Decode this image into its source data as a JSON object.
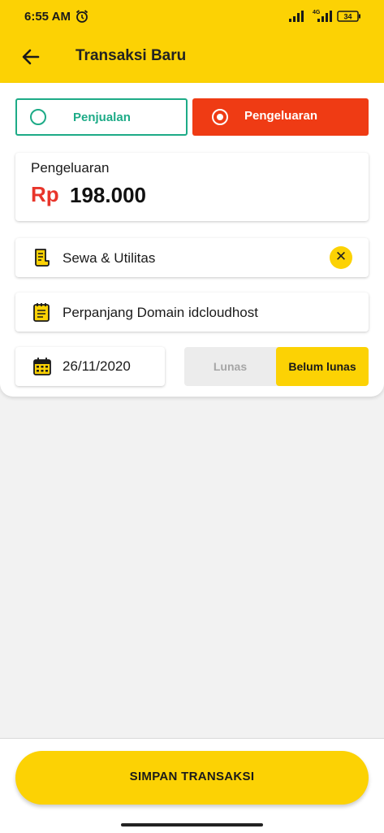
{
  "status_bar": {
    "time": "6:55 AM",
    "network": "4G",
    "battery": "34",
    "icons": [
      "alarm-icon",
      "signal-icon",
      "signal-4g-icon",
      "battery-icon"
    ]
  },
  "app_bar": {
    "title": "Transaksi Baru",
    "back_icon": "arrow-left-icon"
  },
  "transaction_type": {
    "options": [
      {
        "label": "Penjualan",
        "selected": false,
        "color": "#1dab87"
      },
      {
        "label": "Pengeluaran",
        "selected": true,
        "color": "#ef3b14"
      }
    ]
  },
  "amount": {
    "label": "Pengeluaran",
    "currency": "Rp",
    "value": "198.000"
  },
  "category": {
    "value": "Sewa & Utilitas",
    "icon": "receipt-icon",
    "clear_icon": "close-icon"
  },
  "note": {
    "value": "Perpanjang Domain idcloudhost",
    "icon": "notepad-icon"
  },
  "date": {
    "value": "26/11/2020",
    "icon": "calendar-icon"
  },
  "payment_status": {
    "options": [
      {
        "label": "Lunas",
        "selected": false
      },
      {
        "label": "Belum lunas",
        "selected": true
      }
    ]
  },
  "footer": {
    "save_label": "SIMPAN TRANSAKSI"
  },
  "colors": {
    "accent": "#fcd204",
    "expense": "#ef3b14",
    "income": "#1dab87",
    "currency": "#e8352b"
  }
}
